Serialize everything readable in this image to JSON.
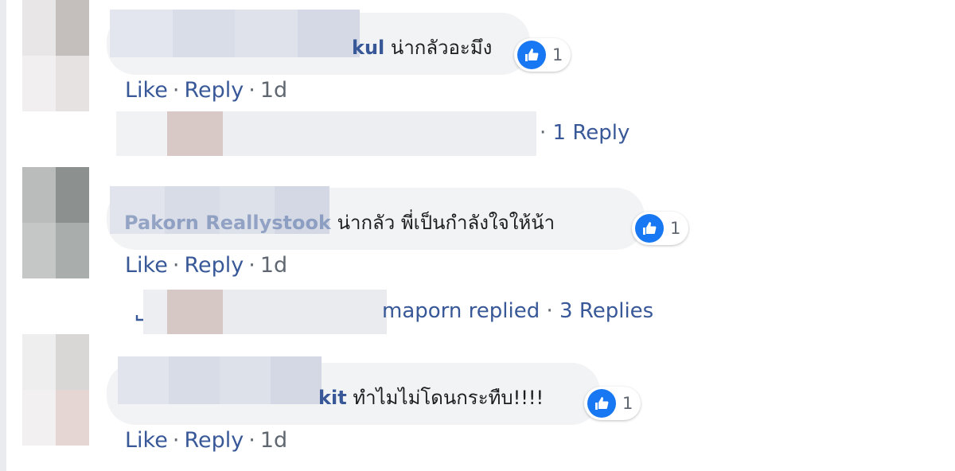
{
  "comments": [
    {
      "name_visible_tail": "kul",
      "text": "น่ากลัวอะมึง",
      "reaction_count": "1",
      "like_label": "Like",
      "reply_label": "Reply",
      "separator": "·",
      "time": "1d",
      "reply_summary": {
        "prefix": "·",
        "label": "1 Reply"
      }
    },
    {
      "name_visible_tail": "Pakorn Reallystook",
      "text": "น่ากลัว พี่เป็นกำลังใจให้น้า",
      "reaction_count": "1",
      "like_label": "Like",
      "reply_label": "Reply",
      "separator": "·",
      "time": "1d",
      "reply_summary": {
        "name_tail": "maporn replied",
        "separator": "·",
        "label": "3 Replies"
      }
    },
    {
      "name_visible_tail": "kit",
      "text": "ทำไมไม่โดนกระทืบ!!!!",
      "reaction_count": "1",
      "like_label": "Like",
      "reply_label": "Reply",
      "separator": "·",
      "time": "1d"
    }
  ],
  "colors": {
    "link": "#385898",
    "muted": "#606770",
    "bubble": "#f2f3f5",
    "like_blue": "#1877f2"
  },
  "icons": {
    "reaction": "like-thumb-icon",
    "reply": "reply-arrow-icon"
  }
}
